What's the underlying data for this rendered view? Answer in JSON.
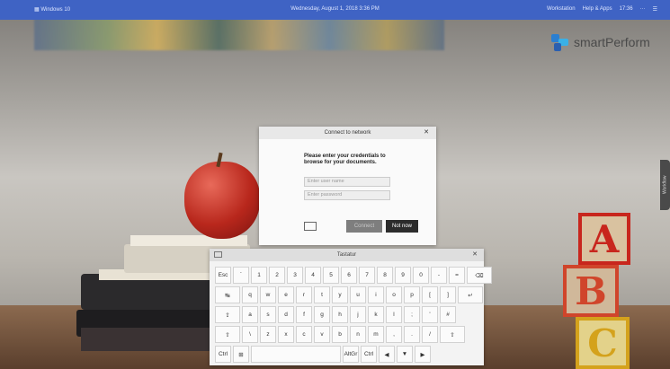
{
  "topbar": {
    "left_label": "Windows 10",
    "datetime": "Wednesday, August 1, 2018  3:36 PM",
    "right_items": [
      "Workstation",
      "Help & Apps",
      "17:36",
      "···",
      "☰"
    ]
  },
  "logo": {
    "text": "smartPerform"
  },
  "sidetab": {
    "label": "Workflow"
  },
  "dialog": {
    "title": "Connect to network",
    "close": "✕",
    "message": "Please enter your credentials to browse for your documents.",
    "username_placeholder": "Enter user name",
    "password_placeholder": "Enter password",
    "connect_label": "Connect",
    "notnow_label": "Not now"
  },
  "keyboard": {
    "title": "Tastatur",
    "close": "✕",
    "row1": [
      "Esc",
      "`",
      "1",
      "2",
      "3",
      "4",
      "5",
      "6",
      "7",
      "8",
      "9",
      "0",
      "-",
      "=",
      "⌫"
    ],
    "row2": [
      "↹",
      "q",
      "w",
      "e",
      "r",
      "t",
      "y",
      "u",
      "i",
      "o",
      "p",
      "[",
      "]",
      "↵"
    ],
    "row3": [
      "⇪",
      "a",
      "s",
      "d",
      "f",
      "g",
      "h",
      "j",
      "k",
      "l",
      ";",
      "'",
      "#"
    ],
    "row4": [
      "⇧",
      "\\",
      "z",
      "x",
      "c",
      "v",
      "b",
      "n",
      "m",
      ",",
      ".",
      "/",
      "⇧"
    ],
    "row5": [
      "Ctrl",
      "⊞",
      "",
      "AltGr",
      "Ctrl",
      "◀",
      "▼",
      "▶"
    ]
  },
  "colors": {
    "topbar": "#3f63c4",
    "connect_btn": "#7e7e7e",
    "notnow_btn": "#2c2c2c"
  }
}
